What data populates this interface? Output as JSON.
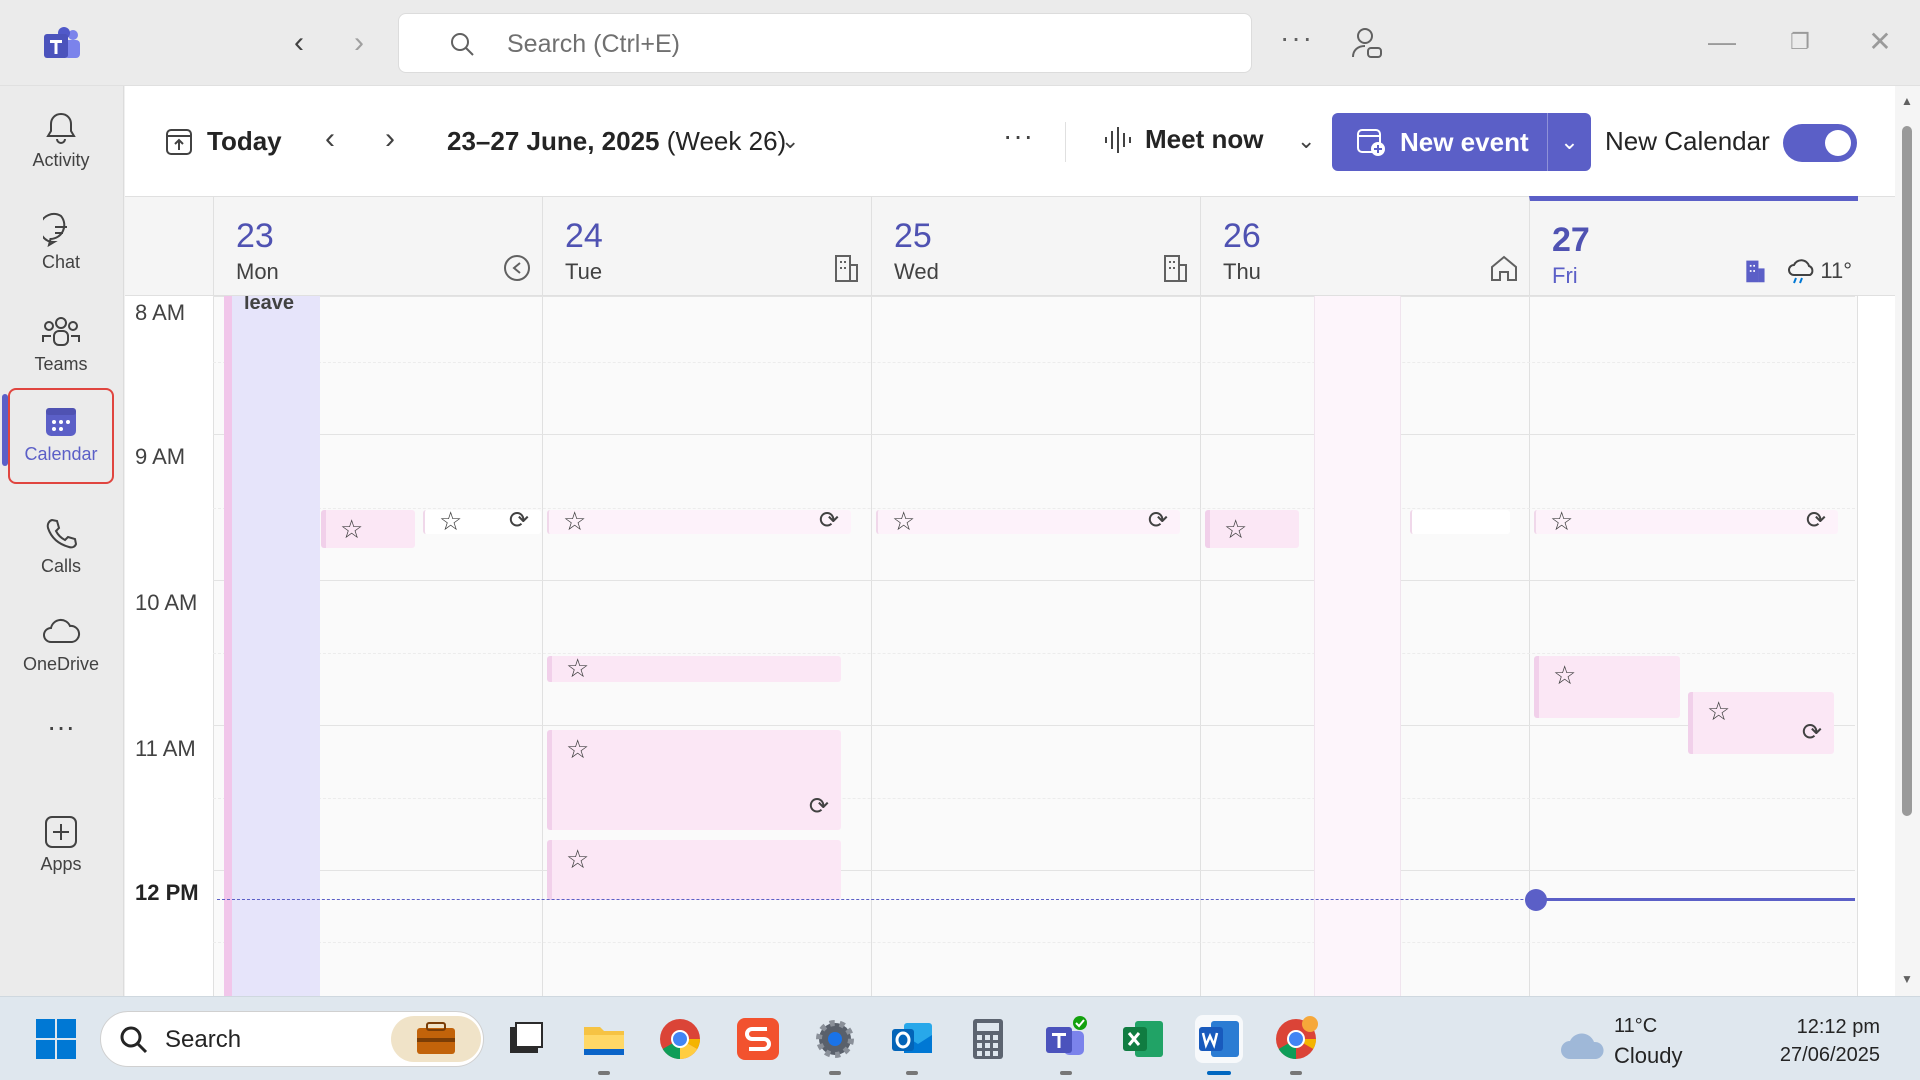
{
  "titlebar": {
    "search_placeholder": "Search (Ctrl+E)",
    "more": "···"
  },
  "rail": {
    "items": [
      {
        "label": "Activity",
        "icon": "bell-icon"
      },
      {
        "label": "Chat",
        "icon": "chat-icon"
      },
      {
        "label": "Teams",
        "icon": "teams-icon"
      },
      {
        "label": "Calendar",
        "icon": "calendar-icon"
      },
      {
        "label": "Calls",
        "icon": "phone-icon"
      },
      {
        "label": "OneDrive",
        "icon": "cloud-icon"
      },
      {
        "label": "Apps",
        "icon": "add-apps-icon"
      }
    ],
    "more": "···",
    "active": "Calendar"
  },
  "toolbar": {
    "today": "Today",
    "range": "23–27 June, 2025",
    "week": "(Week 26)",
    "more": "···",
    "meet_now": "Meet now",
    "new_event": "New event",
    "new_calendar": "New Calendar",
    "new_calendar_on": true
  },
  "days": [
    {
      "num": "23",
      "name": "Mon",
      "icon": "leave-icon"
    },
    {
      "num": "24",
      "name": "Tue",
      "icon": "office-building-icon"
    },
    {
      "num": "25",
      "name": "Wed",
      "icon": "office-building-icon"
    },
    {
      "num": "26",
      "name": "Thu",
      "icon": "home-icon"
    },
    {
      "num": "27",
      "name": "Fri",
      "icon": "office-building-icon",
      "today": true,
      "weather": "11°"
    }
  ],
  "times": [
    "8 AM",
    "9 AM",
    "10 AM",
    "11 AM",
    "12 PM"
  ],
  "leave_label": "leave",
  "colors": {
    "accent": "#5b5fc7",
    "event_bg": "#fbe7f5",
    "leave_bg": "#e6e4fa"
  },
  "taskbar": {
    "search": "Search",
    "weather_temp": "11°C",
    "weather_cond": "Cloudy",
    "time": "12:12 pm",
    "date": "27/06/2025"
  }
}
